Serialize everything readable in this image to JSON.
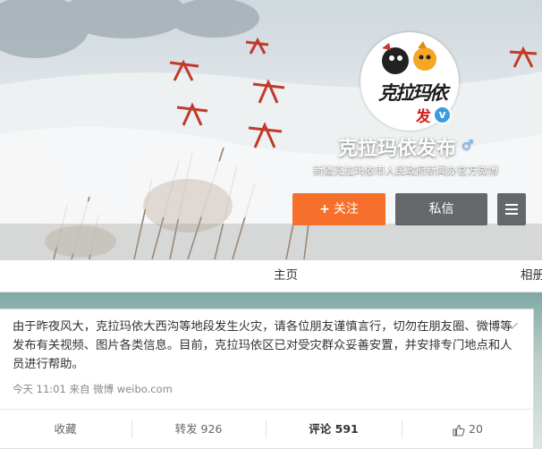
{
  "profile": {
    "avatar_text": "克拉玛依",
    "avatar_sub": "发",
    "verified_mark": "v",
    "name": "克拉玛依发布",
    "gender_symbol": "♂",
    "description": "新疆克拉玛依市人民政府新闻办官方微博"
  },
  "buttons": {
    "follow_icon": "+",
    "follow_label": "关注",
    "message_label": "私信",
    "more_icon": "menu-icon"
  },
  "tabs": [
    {
      "label": "主页"
    },
    {
      "label": "相册"
    }
  ],
  "post": {
    "text": "由于昨夜风大，克拉玛依大西沟等地段发生火灾，请各位朋友谨慎言行，切勿在朋友圈、微博等发布有关视频、图片各类信息。目前，克拉玛依区已对受灾群众妥善安置，并安排专门地点和人员进行帮助。",
    "meta": "今天 11:01 来自 微博 weibo.com",
    "actions": {
      "favorite": "收藏",
      "repost": "转发 926",
      "comment": "评论 591",
      "like": "20"
    }
  },
  "colors": {
    "follow_button": "#f6702b",
    "verified_badge": "#3a9be3",
    "dark_button": "#46484c"
  }
}
